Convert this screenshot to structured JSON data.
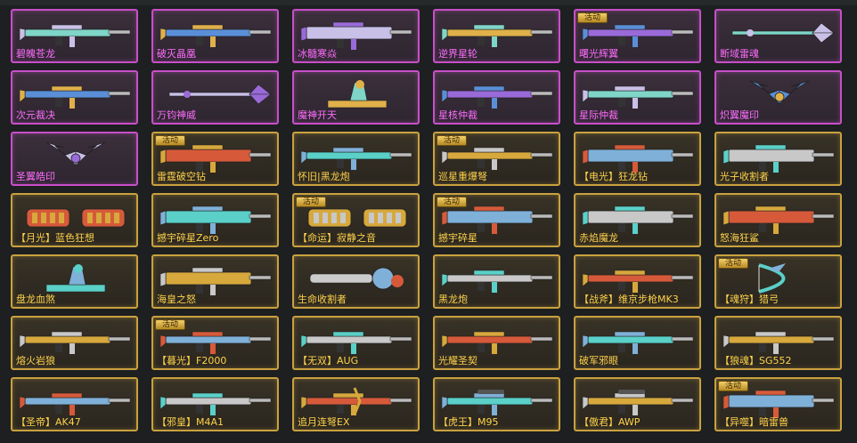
{
  "colors": {
    "purple_border": "#c84fc8",
    "purple_text": "#ff6cff",
    "gold_border": "#c9a13e",
    "gold_text": "#ffd24a",
    "badge": "#e3b54a"
  },
  "weapons": [
    {
      "name": "碧魄苍龙",
      "rarity": "purple",
      "badge": "",
      "icon": "rifle-icon"
    },
    {
      "name": "破灭晶凰",
      "rarity": "purple",
      "badge": "",
      "icon": "rifle-icon"
    },
    {
      "name": "冰髓寒焱",
      "rarity": "purple",
      "badge": "",
      "icon": "heavy-gun-icon"
    },
    {
      "name": "逆界星轮",
      "rarity": "purple",
      "badge": "",
      "icon": "rifle-icon"
    },
    {
      "name": "曙光辉翼",
      "rarity": "purple",
      "badge": "活动",
      "icon": "rifle-icon"
    },
    {
      "name": "断域雷魂",
      "rarity": "purple",
      "badge": "",
      "icon": "staff-icon"
    },
    {
      "name": "次元裁决",
      "rarity": "purple",
      "badge": "",
      "icon": "blaster-icon"
    },
    {
      "name": "万钧神威",
      "rarity": "purple",
      "badge": "",
      "icon": "spear-icon"
    },
    {
      "name": "魔神开天",
      "rarity": "purple",
      "badge": "",
      "icon": "axe-icon"
    },
    {
      "name": "星核仲裁",
      "rarity": "purple",
      "badge": "",
      "icon": "rifle-icon"
    },
    {
      "name": "星际仲裁",
      "rarity": "purple",
      "badge": "",
      "icon": "rifle-icon"
    },
    {
      "name": "炽翼魔印",
      "rarity": "purple",
      "badge": "",
      "icon": "wing-icon"
    },
    {
      "name": "圣翼皓印",
      "rarity": "purple",
      "badge": "",
      "icon": "wing-icon"
    },
    {
      "name": "雷霆破空钻",
      "rarity": "gold",
      "badge": "活动",
      "icon": "drill-icon"
    },
    {
      "name": "怀旧|黑龙炮",
      "rarity": "gold",
      "badge": "",
      "icon": "rifle-icon"
    },
    {
      "name": "巡星重爆弩",
      "rarity": "gold",
      "badge": "活动",
      "icon": "rifle-icon"
    },
    {
      "name": "【电光】狂龙钻",
      "rarity": "gold",
      "badge": "",
      "icon": "drill-icon"
    },
    {
      "name": "光子收割者",
      "rarity": "gold",
      "badge": "",
      "icon": "heavy-gun-icon"
    },
    {
      "name": "【月光】蓝色狂想",
      "rarity": "gold",
      "badge": "",
      "icon": "gauntlet-icon"
    },
    {
      "name": "撼宇碎星Zero",
      "rarity": "gold",
      "badge": "",
      "icon": "heavy-gun-icon"
    },
    {
      "name": "【命运】寂静之音",
      "rarity": "gold",
      "badge": "活动",
      "icon": "gauntlet-icon"
    },
    {
      "name": "撼宇碎星",
      "rarity": "gold",
      "badge": "活动",
      "icon": "heavy-gun-icon"
    },
    {
      "name": "赤焰魔龙",
      "rarity": "gold",
      "badge": "",
      "icon": "dragon-gun-icon"
    },
    {
      "name": "怒海狂鲨",
      "rarity": "gold",
      "badge": "",
      "icon": "drill-icon"
    },
    {
      "name": "盘龙血煞",
      "rarity": "gold",
      "badge": "",
      "icon": "mortar-icon"
    },
    {
      "name": "海皇之怒",
      "rarity": "gold",
      "badge": "",
      "icon": "heavy-gun-icon"
    },
    {
      "name": "生命收割者",
      "rarity": "gold",
      "badge": "",
      "icon": "chainsaw-icon"
    },
    {
      "name": "黑龙炮",
      "rarity": "gold",
      "badge": "",
      "icon": "rifle-icon"
    },
    {
      "name": "【战斧】维京步枪MK3",
      "rarity": "gold",
      "badge": "",
      "icon": "rifle-icon"
    },
    {
      "name": "【魂狩】猎弓",
      "rarity": "gold",
      "badge": "活动",
      "icon": "bow-icon"
    },
    {
      "name": "熔火岩狼",
      "rarity": "gold",
      "badge": "",
      "icon": "rifle-icon"
    },
    {
      "name": "【暮光】F2000",
      "rarity": "gold",
      "badge": "活动",
      "icon": "rifle-icon"
    },
    {
      "name": "【无双】AUG",
      "rarity": "gold",
      "badge": "",
      "icon": "rifle-icon"
    },
    {
      "name": "光耀圣契",
      "rarity": "gold",
      "badge": "",
      "icon": "rifle-icon"
    },
    {
      "name": "破军邪眼",
      "rarity": "gold",
      "badge": "",
      "icon": "rifle-icon"
    },
    {
      "name": "【狼魂】SG552",
      "rarity": "gold",
      "badge": "",
      "icon": "rifle-icon"
    },
    {
      "name": "【圣帝】AK47",
      "rarity": "gold",
      "badge": "",
      "icon": "rifle-icon"
    },
    {
      "name": "【邪皇】M4A1",
      "rarity": "gold",
      "badge": "",
      "icon": "rifle-icon"
    },
    {
      "name": "追月连弩EX",
      "rarity": "gold",
      "badge": "",
      "icon": "crossbow-icon"
    },
    {
      "name": "【虎王】M95",
      "rarity": "gold",
      "badge": "",
      "icon": "sniper-icon"
    },
    {
      "name": "【傲君】AWP",
      "rarity": "gold",
      "badge": "",
      "icon": "sniper-icon"
    },
    {
      "name": "【异噬】暗雷兽",
      "rarity": "gold",
      "badge": "活动",
      "icon": "heavy-gun-icon"
    }
  ]
}
